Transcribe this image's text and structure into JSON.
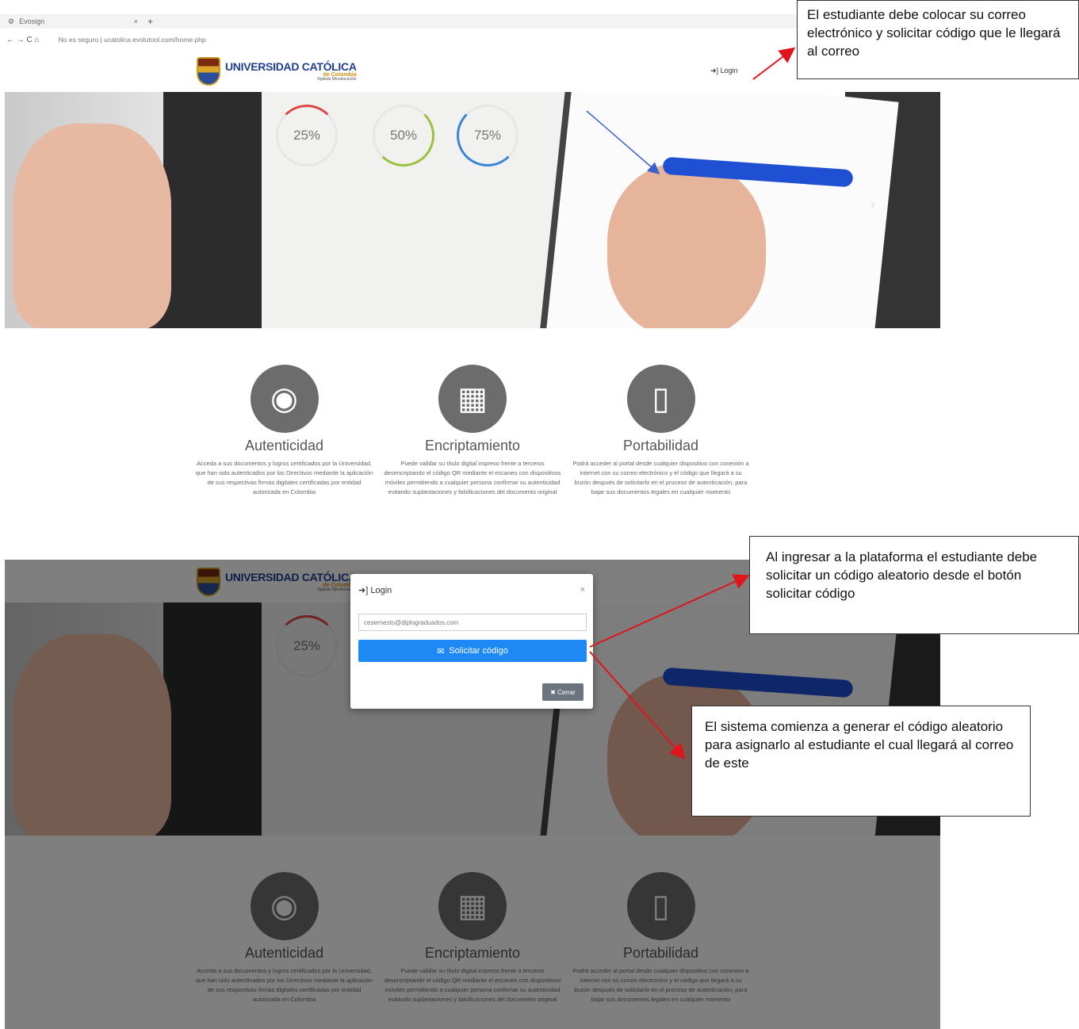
{
  "browser": {
    "tab_title": "Evosign",
    "tab_close": "×",
    "tab_new": "+",
    "nav": "← → C ⌂",
    "url": "No es seguro | ucatolica.evolutool.com/home.php"
  },
  "header": {
    "logo_main": "UNIVERSIDAD CATÓLICA",
    "logo_sub": "de Colombia",
    "logo_sub2": "Vigilada Mineducación",
    "login_label": "Login"
  },
  "hero": {
    "stats": [
      "25%",
      "50%",
      "75%"
    ],
    "next": "›"
  },
  "features": [
    {
      "title": "Autenticidad",
      "desc": "Acceda a sus documentos y logros certificados por la Universidad, que han sido autenticados por los Directivos mediante la aplicación de sus respectivas firmas digitales certificadas por entidad autorizada en Colombia"
    },
    {
      "title": "Encriptamiento",
      "desc": "Puede validar su título digital impreso frente a terceros desencriptando el código QR mediante el escaneo con dispositivos móviles permitiendo a cualquier persona confirmar su autenticidad evitando suplantaciones y falsificaciones del documento original"
    },
    {
      "title": "Portabilidad",
      "desc": "Podrá acceder al portal desde cualquier dispositivo con conexión a internet con su correo electrónico y el código que llegará a su buzón después de solicitarlo en el proceso de autenticación, para bajar sus documentos legales en cualquier momento"
    }
  ],
  "modal": {
    "title": "Login",
    "close": "×",
    "email": "cesernesto@diplograduados.com",
    "request_button": "Solicitar código",
    "cancel_button": "Cerrar"
  },
  "callouts": {
    "c1": "El estudiante debe colocar su correo electrónico y solicitar código que le llegará al correo",
    "c2": "Al ingresar a la plataforma el estudiante debe solicitar un código aleatorio desde el botón solicitar código",
    "c3": "El sistema comienza a generar el código aleatorio para asignarlo al estudiante el cual llegará al correo de este"
  }
}
